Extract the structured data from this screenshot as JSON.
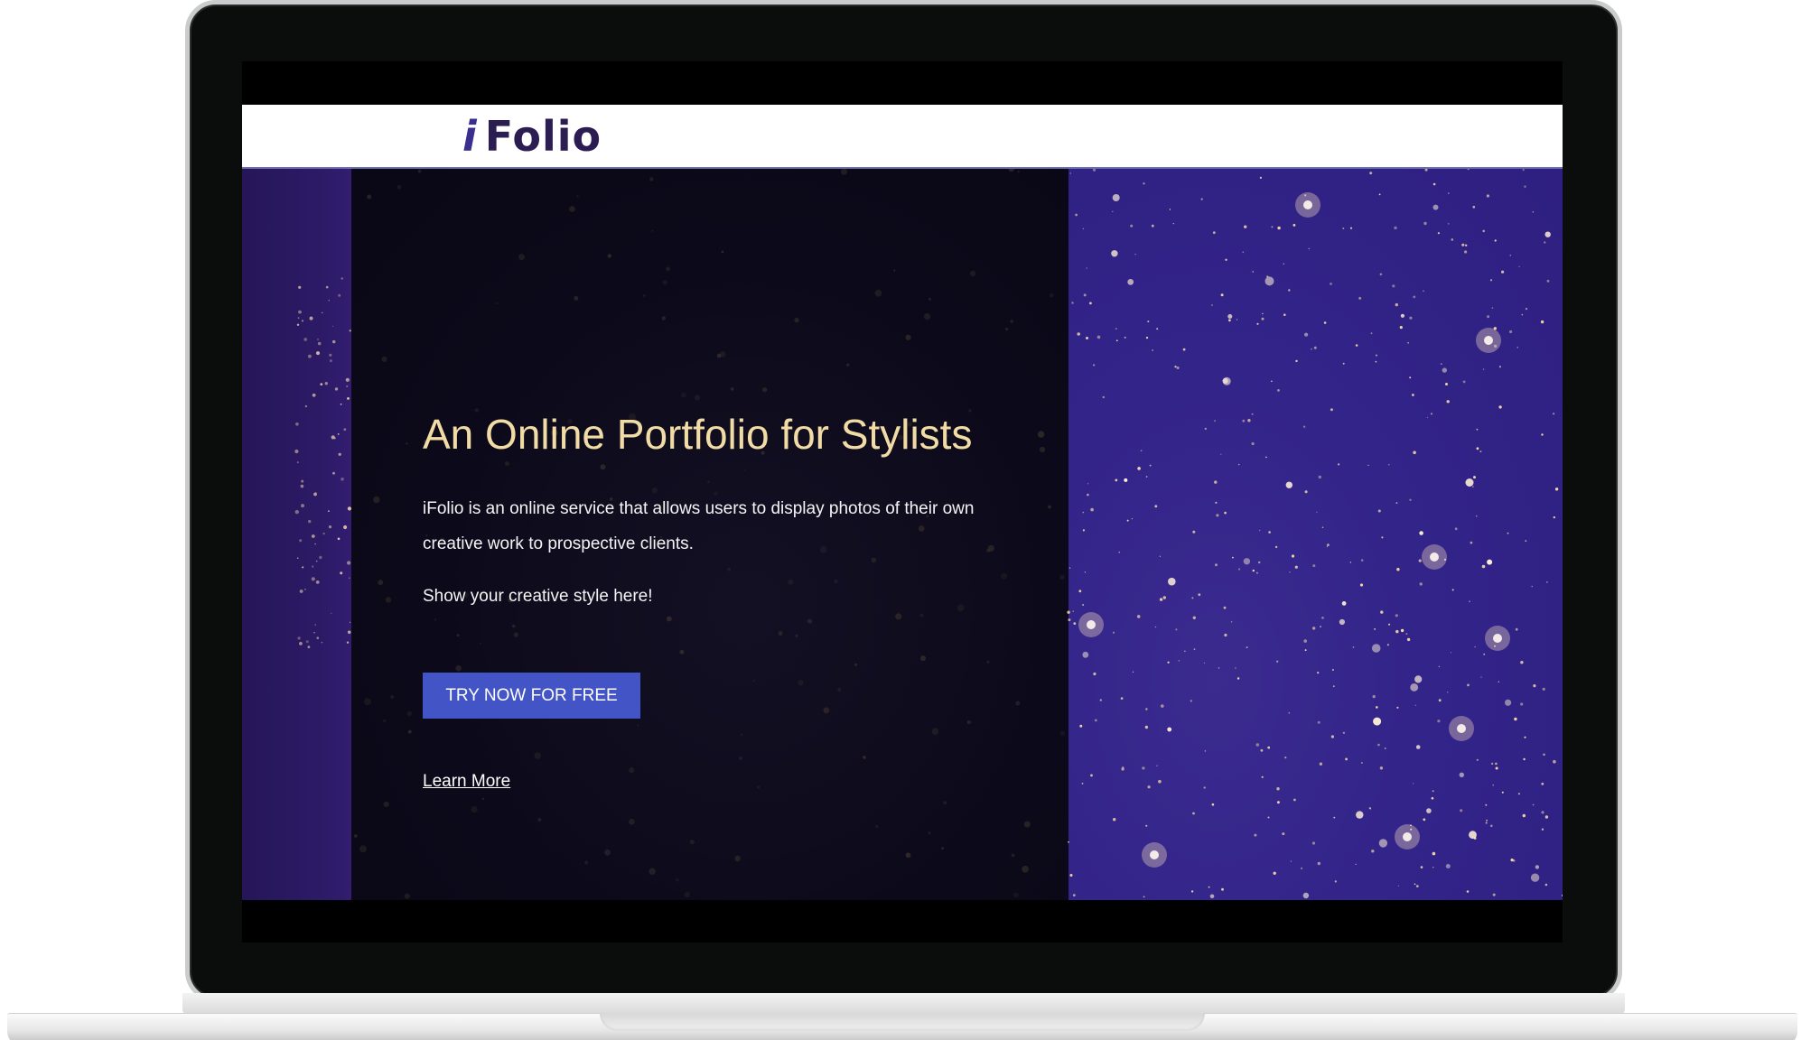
{
  "site": {
    "logo_i": "i",
    "logo_rest": "Folio"
  },
  "hero": {
    "title": "An Online Portfolio for Stylists",
    "description": "iFolio is an online service that allows users to display photos of their own creative work to prospective clients.",
    "tagline": "Show your creative style here!",
    "cta_label": "TRY NOW FOR FREE",
    "learn_more_label": "Learn More"
  },
  "colors": {
    "header_bg": "#ffffff",
    "logo": "#2b1c52",
    "title": "#f1dca5",
    "cta_bg": "#4355c6",
    "dark_panel": "#0c0a1a",
    "purple_panel": "#33248a"
  },
  "icons": {
    "background": "city-lights-earth-image"
  }
}
